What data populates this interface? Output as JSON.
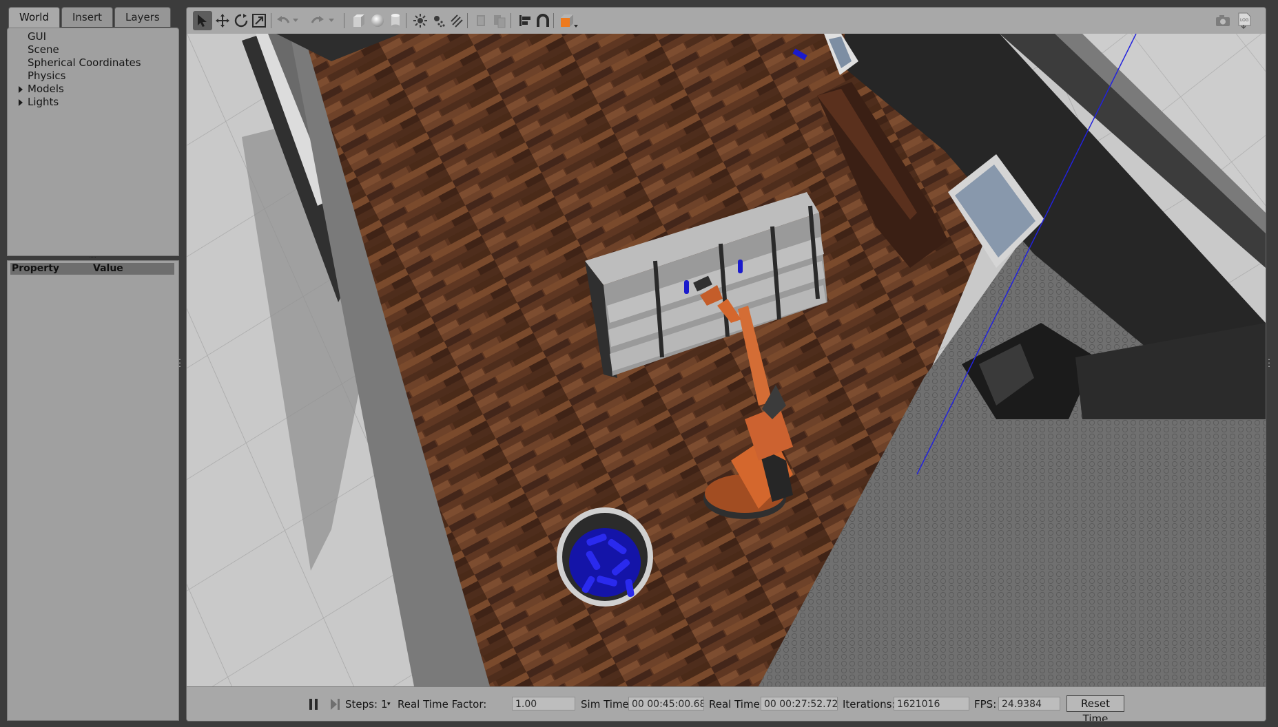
{
  "left_panel": {
    "tabs": [
      {
        "label": "World",
        "active": true
      },
      {
        "label": "Insert",
        "active": false
      },
      {
        "label": "Layers",
        "active": false
      }
    ],
    "tree": [
      {
        "label": "GUI",
        "expandable": false
      },
      {
        "label": "Scene",
        "expandable": false
      },
      {
        "label": "Spherical Coordinates",
        "expandable": false
      },
      {
        "label": "Physics",
        "expandable": false
      },
      {
        "label": "Models",
        "expandable": true
      },
      {
        "label": "Lights",
        "expandable": true
      }
    ],
    "property_header": {
      "property": "Property",
      "value": "Value"
    }
  },
  "toolbar": {
    "tools": [
      "select-arrow-icon",
      "translate-icon",
      "rotate-icon",
      "scale-icon",
      "undo-icon",
      "undo-dropdown-icon",
      "redo-icon",
      "redo-dropdown-icon",
      "box-icon",
      "sphere-icon",
      "cylinder-icon",
      "point-light-icon",
      "spot-light-icon",
      "directional-light-icon",
      "copy-icon",
      "paste-icon",
      "align-icon",
      "snap-magnet-icon",
      "view-angle-icon",
      "screenshot-camera-icon",
      "log-icon"
    ]
  },
  "status_bar": {
    "steps_label": "Steps:",
    "steps_value": "1",
    "real_time_factor_label": "Real Time Factor:",
    "real_time_factor_value": "1.00",
    "sim_time_label": "Sim Time:",
    "sim_time_value": "00 00:45:00.683",
    "real_time_label": "Real Time:",
    "real_time_value": "00 00:27:52.722",
    "iterations_label": "Iterations:",
    "iterations_value": "1621016",
    "fps_label": "FPS:",
    "fps_value": "24.9384",
    "reset_time_label": "Reset Time"
  },
  "colors": {
    "robot_arm": "#d4672d",
    "target_items": "#1a1acc",
    "floor_wood": "#5a3320",
    "tile_floor": "#c8c8c8",
    "hex_carpet": "#6f6f6f"
  }
}
